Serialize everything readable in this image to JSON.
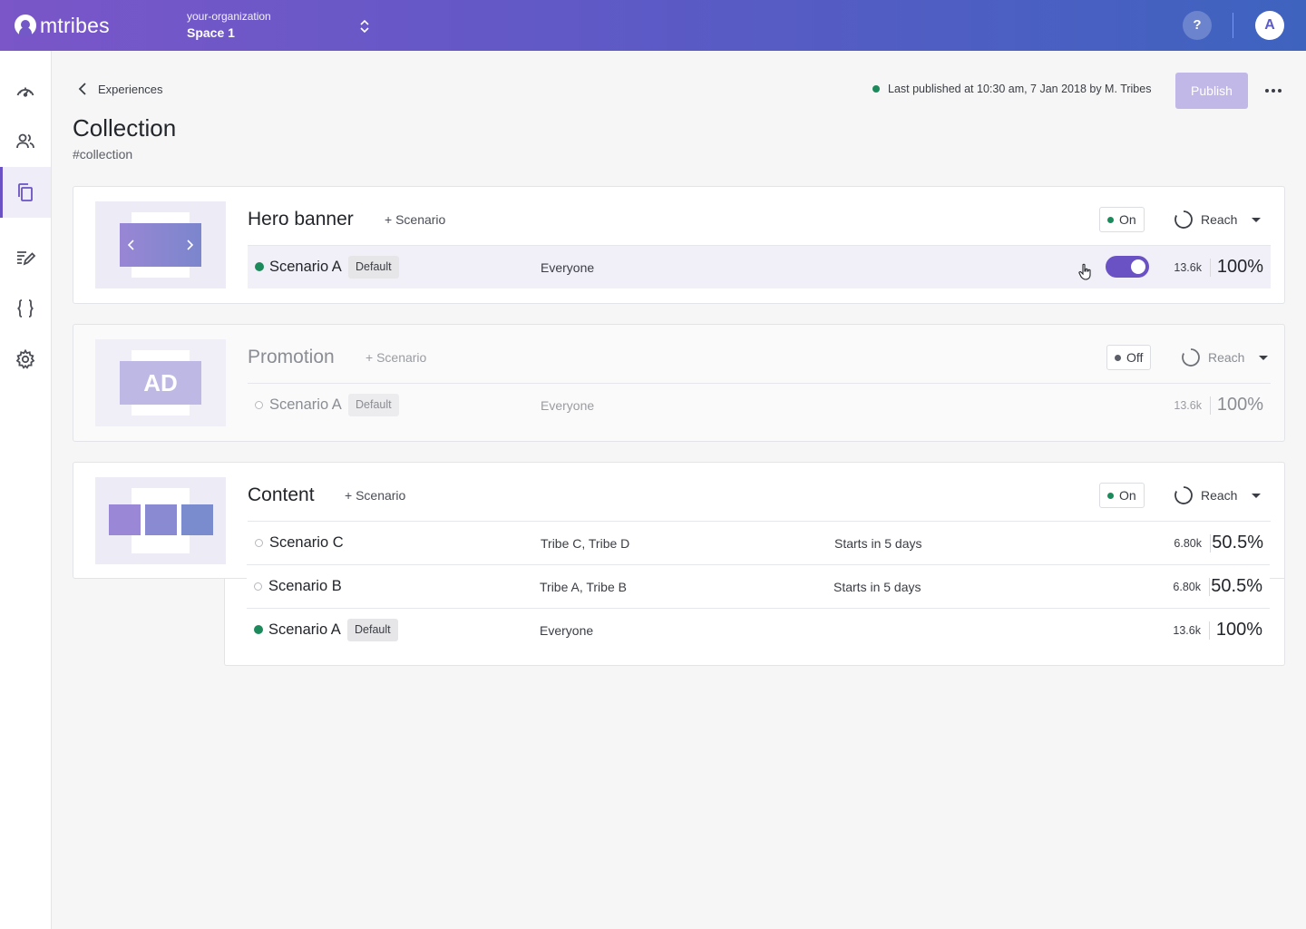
{
  "brand": {
    "name": "mtribes"
  },
  "topbar": {
    "organization": "your-organization",
    "space": "Space 1",
    "help_label": "?",
    "avatar_initial": "A"
  },
  "sidebar": {
    "items": [
      {
        "id": "dashboard",
        "icon": "gauge-icon"
      },
      {
        "id": "tribes",
        "icon": "users-icon"
      },
      {
        "id": "experiences",
        "icon": "copy-icon",
        "active": true
      },
      {
        "id": "edit",
        "icon": "edit-list-icon"
      },
      {
        "id": "code",
        "icon": "braces-icon"
      },
      {
        "id": "settings",
        "icon": "gear-icon"
      }
    ]
  },
  "header": {
    "back_label": "Experiences",
    "title": "Collection",
    "slug": "#collection",
    "published_text": "Last published at 10:30 am, 7 Jan 2018 by M. Tribes",
    "publish_label": "Publish"
  },
  "cards": [
    {
      "title": "Hero banner",
      "add_scenario": "+ Scenario",
      "status": "On",
      "reach_label": "Reach",
      "scenarios": [
        {
          "name": "Scenario A",
          "default_label": "Default",
          "audience": "Everyone",
          "count": "13.6k",
          "percent": "100%",
          "toggle_on": true
        }
      ]
    },
    {
      "title": "Promotion",
      "add_scenario": "+ Scenario",
      "status": "Off",
      "reach_label": "Reach",
      "thumb_text": "AD",
      "scenarios": [
        {
          "name": "Scenario A",
          "default_label": "Default",
          "audience": "Everyone",
          "count": "13.6k",
          "percent": "100%"
        }
      ]
    },
    {
      "title": "Content",
      "add_scenario": "+ Scenario",
      "status": "On",
      "reach_label": "Reach",
      "scenarios": [
        {
          "name": "Scenario C",
          "audience": "Tribe C, Tribe D",
          "schedule": "Starts in 5 days",
          "count": "6.80k",
          "percent": "50.5%"
        },
        {
          "name": "Scenario B",
          "audience": "Tribe A, Tribe B",
          "schedule": "Starts in 5 days",
          "count": "6.80k",
          "percent": "50.5%"
        },
        {
          "name": "Scenario A",
          "default_label": "Default",
          "audience": "Everyone",
          "count": "13.6k",
          "percent": "100%"
        }
      ]
    }
  ],
  "colors": {
    "accent": "#6a52c4",
    "active_status": "#1d8a5c",
    "publish_disabled": "#c2b8e8"
  }
}
